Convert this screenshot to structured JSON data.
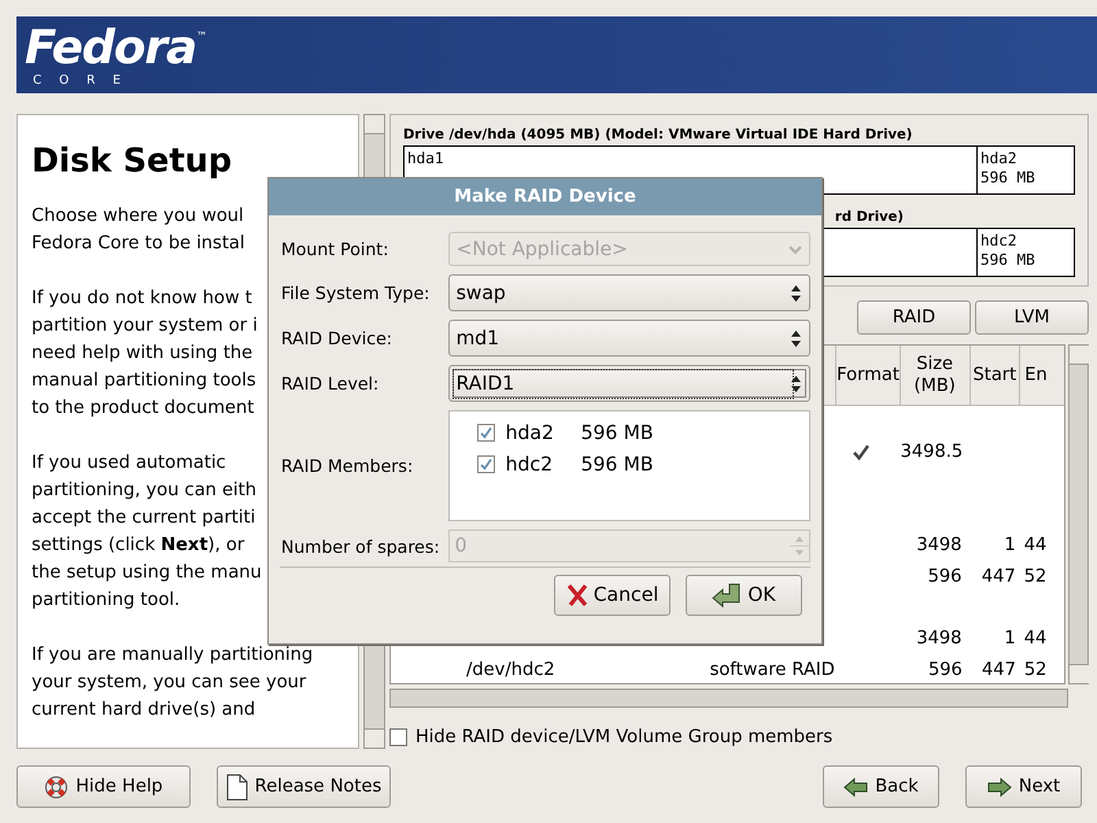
{
  "banner": {
    "logo": "Fedora",
    "trademark": "™",
    "subtitle": "C O R E"
  },
  "help": {
    "title": "Disk Setup",
    "paragraphs": [
      [
        "Choose where you woul",
        "Fedora Core to be instal"
      ],
      [
        "If you do not know how t",
        "partition your system or i",
        "need help with using the",
        "manual partitioning tools",
        "to the product document"
      ],
      [
        "If you used automatic",
        "partitioning, you can eith",
        "accept the current partiti",
        "settings (click **Next**), or",
        "the setup using the manu",
        "partitioning tool."
      ],
      [
        "If you are manually partitioning",
        "your system, you can see your",
        "current hard drive(s) and"
      ]
    ]
  },
  "drives": [
    {
      "title": "Drive /dev/hda (4095 MB) (Model: VMware Virtual IDE Hard Drive)",
      "segments": [
        {
          "name": "hda1"
        },
        {
          "name": "hda2",
          "size": "596 MB"
        }
      ]
    },
    {
      "title": "rd Drive)",
      "segments": [
        {
          "name": "hdc2",
          "size": "596 MB"
        }
      ]
    }
  ],
  "actions": [
    "RAID",
    "LVM"
  ],
  "table": {
    "columns": [
      "Format",
      "Size (MB)",
      "Start",
      "En"
    ],
    "rows": [
      {
        "format": false
      },
      {
        "format": true,
        "size": "3498.5"
      },
      {
        "format": false
      },
      {
        "format": false
      },
      {
        "format": false,
        "size": "3498",
        "start": "1",
        "end": "44"
      },
      {
        "format": false,
        "size": "596",
        "start": "447",
        "end": "52"
      },
      {
        "format": false
      },
      {
        "format": false,
        "size": "3498",
        "start": "1",
        "end": "44"
      },
      {
        "format": false,
        "device": "/dev/hdc2",
        "type": "software RAID",
        "size": "596",
        "start": "447",
        "end": "52"
      }
    ]
  },
  "hide_members": {
    "label": "Hide RAID device/LVM Volume Group members",
    "checked": false
  },
  "footer": {
    "left": [
      {
        "kind": "help",
        "label": "Hide Help"
      },
      {
        "kind": "notes",
        "label": "Release Notes"
      }
    ],
    "right": [
      {
        "kind": "back",
        "label": "Back"
      },
      {
        "kind": "next",
        "label": "Next"
      }
    ]
  },
  "dialog": {
    "title": "Make RAID Device",
    "fields": [
      {
        "kind": "combo",
        "label": "Mount Point:",
        "value": "<Not Applicable>",
        "disabled": true,
        "focused": false
      },
      {
        "kind": "combo",
        "label": "File System Type:",
        "value": "swap",
        "disabled": false,
        "focused": false
      },
      {
        "kind": "combo",
        "label": "RAID Device:",
        "value": "md1",
        "disabled": false,
        "focused": false
      },
      {
        "kind": "combo",
        "label": "RAID Level:",
        "value": "RAID1",
        "disabled": false,
        "focused": true
      },
      {
        "kind": "members",
        "label": "RAID Members:",
        "members": [
          {
            "name": "hda2",
            "size": "596 MB",
            "checked": true
          },
          {
            "name": "hdc2",
            "size": "596 MB",
            "checked": true
          }
        ]
      },
      {
        "kind": "spin",
        "label": "Number of spares:",
        "value": "0",
        "disabled": true
      }
    ],
    "buttons": [
      {
        "kind": "cancel",
        "label": "Cancel"
      },
      {
        "kind": "ok",
        "label": "OK"
      }
    ]
  }
}
